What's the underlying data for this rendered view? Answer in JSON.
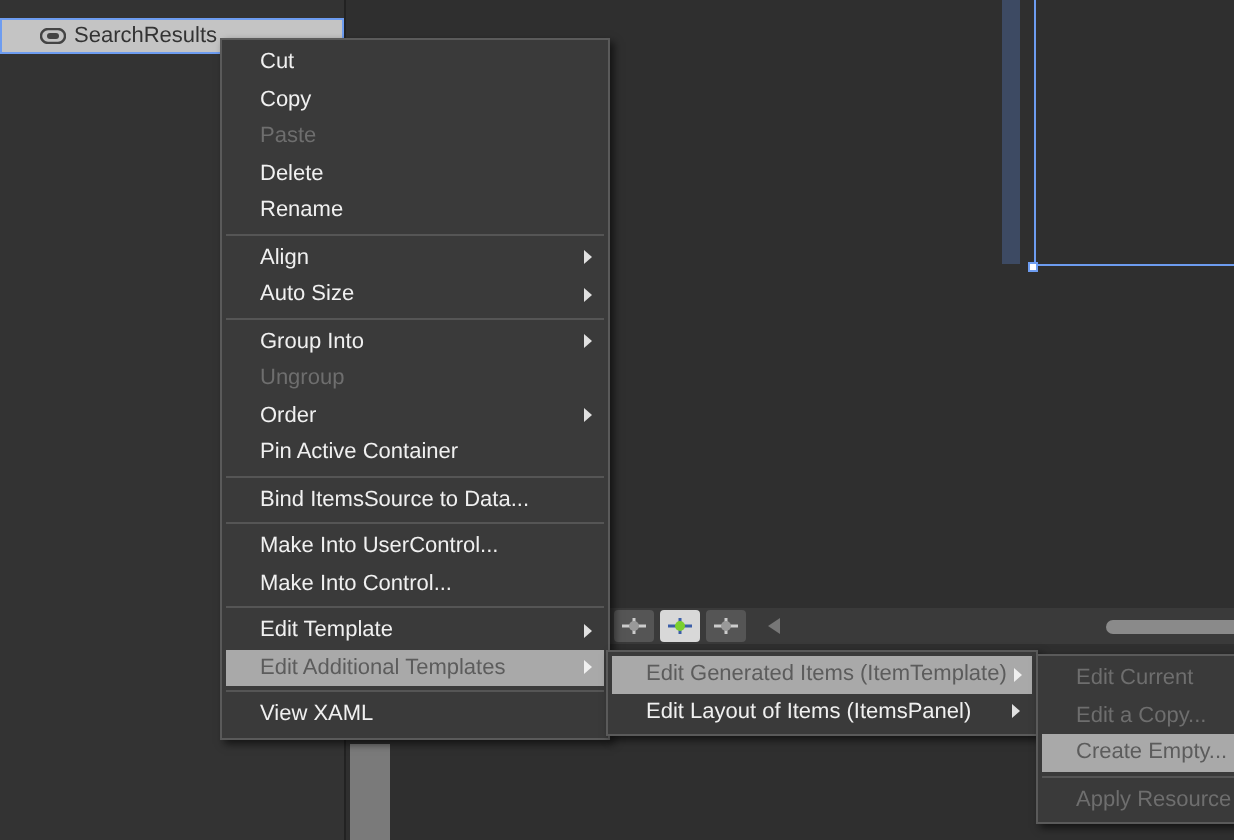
{
  "tree": {
    "items": [
      {
        "label": "SearchResults",
        "selected": true
      }
    ]
  },
  "context_menu": {
    "groups": [
      [
        {
          "label": "Cut",
          "disabled": false,
          "submenu": false,
          "selected": false
        },
        {
          "label": "Copy",
          "disabled": false,
          "submenu": false,
          "selected": false
        },
        {
          "label": "Paste",
          "disabled": true,
          "submenu": false,
          "selected": false
        },
        {
          "label": "Delete",
          "disabled": false,
          "submenu": false,
          "selected": false
        },
        {
          "label": "Rename",
          "disabled": false,
          "submenu": false,
          "selected": false
        }
      ],
      [
        {
          "label": "Align",
          "disabled": false,
          "submenu": true,
          "selected": false
        },
        {
          "label": "Auto Size",
          "disabled": false,
          "submenu": true,
          "selected": false
        }
      ],
      [
        {
          "label": "Group Into",
          "disabled": false,
          "submenu": true,
          "selected": false
        },
        {
          "label": "Ungroup",
          "disabled": true,
          "submenu": false,
          "selected": false
        },
        {
          "label": "Order",
          "disabled": false,
          "submenu": true,
          "selected": false
        },
        {
          "label": "Pin Active Container",
          "disabled": false,
          "submenu": false,
          "selected": false
        }
      ],
      [
        {
          "label": "Bind ItemsSource to Data...",
          "disabled": false,
          "submenu": false,
          "selected": false
        }
      ],
      [
        {
          "label": "Make Into UserControl...",
          "disabled": false,
          "submenu": false,
          "selected": false
        },
        {
          "label": "Make Into Control...",
          "disabled": false,
          "submenu": false,
          "selected": false
        }
      ],
      [
        {
          "label": "Edit Template",
          "disabled": false,
          "submenu": true,
          "selected": false
        },
        {
          "label": "Edit Additional Templates",
          "disabled": false,
          "submenu": true,
          "selected": true
        }
      ],
      [
        {
          "label": "View XAML",
          "disabled": false,
          "submenu": false,
          "selected": false
        }
      ]
    ]
  },
  "submenu": {
    "groups": [
      [
        {
          "label": "Edit Generated Items (ItemTemplate)",
          "disabled": false,
          "submenu": true,
          "selected": true
        },
        {
          "label": "Edit Layout of Items (ItemsPanel)",
          "disabled": false,
          "submenu": true,
          "selected": false
        }
      ]
    ]
  },
  "nested_submenu": {
    "groups": [
      [
        {
          "label": "Edit Current",
          "disabled": true,
          "submenu": false,
          "selected": false
        },
        {
          "label": "Edit a Copy...",
          "disabled": true,
          "submenu": false,
          "selected": false
        },
        {
          "label": "Create Empty...",
          "disabled": false,
          "submenu": false,
          "selected": true
        }
      ],
      [
        {
          "label": "Apply Resource",
          "disabled": true,
          "submenu": false,
          "selected": false
        }
      ]
    ]
  },
  "toolbar": {
    "tools": [
      {
        "selected": false
      },
      {
        "selected": true
      },
      {
        "selected": false
      }
    ]
  }
}
